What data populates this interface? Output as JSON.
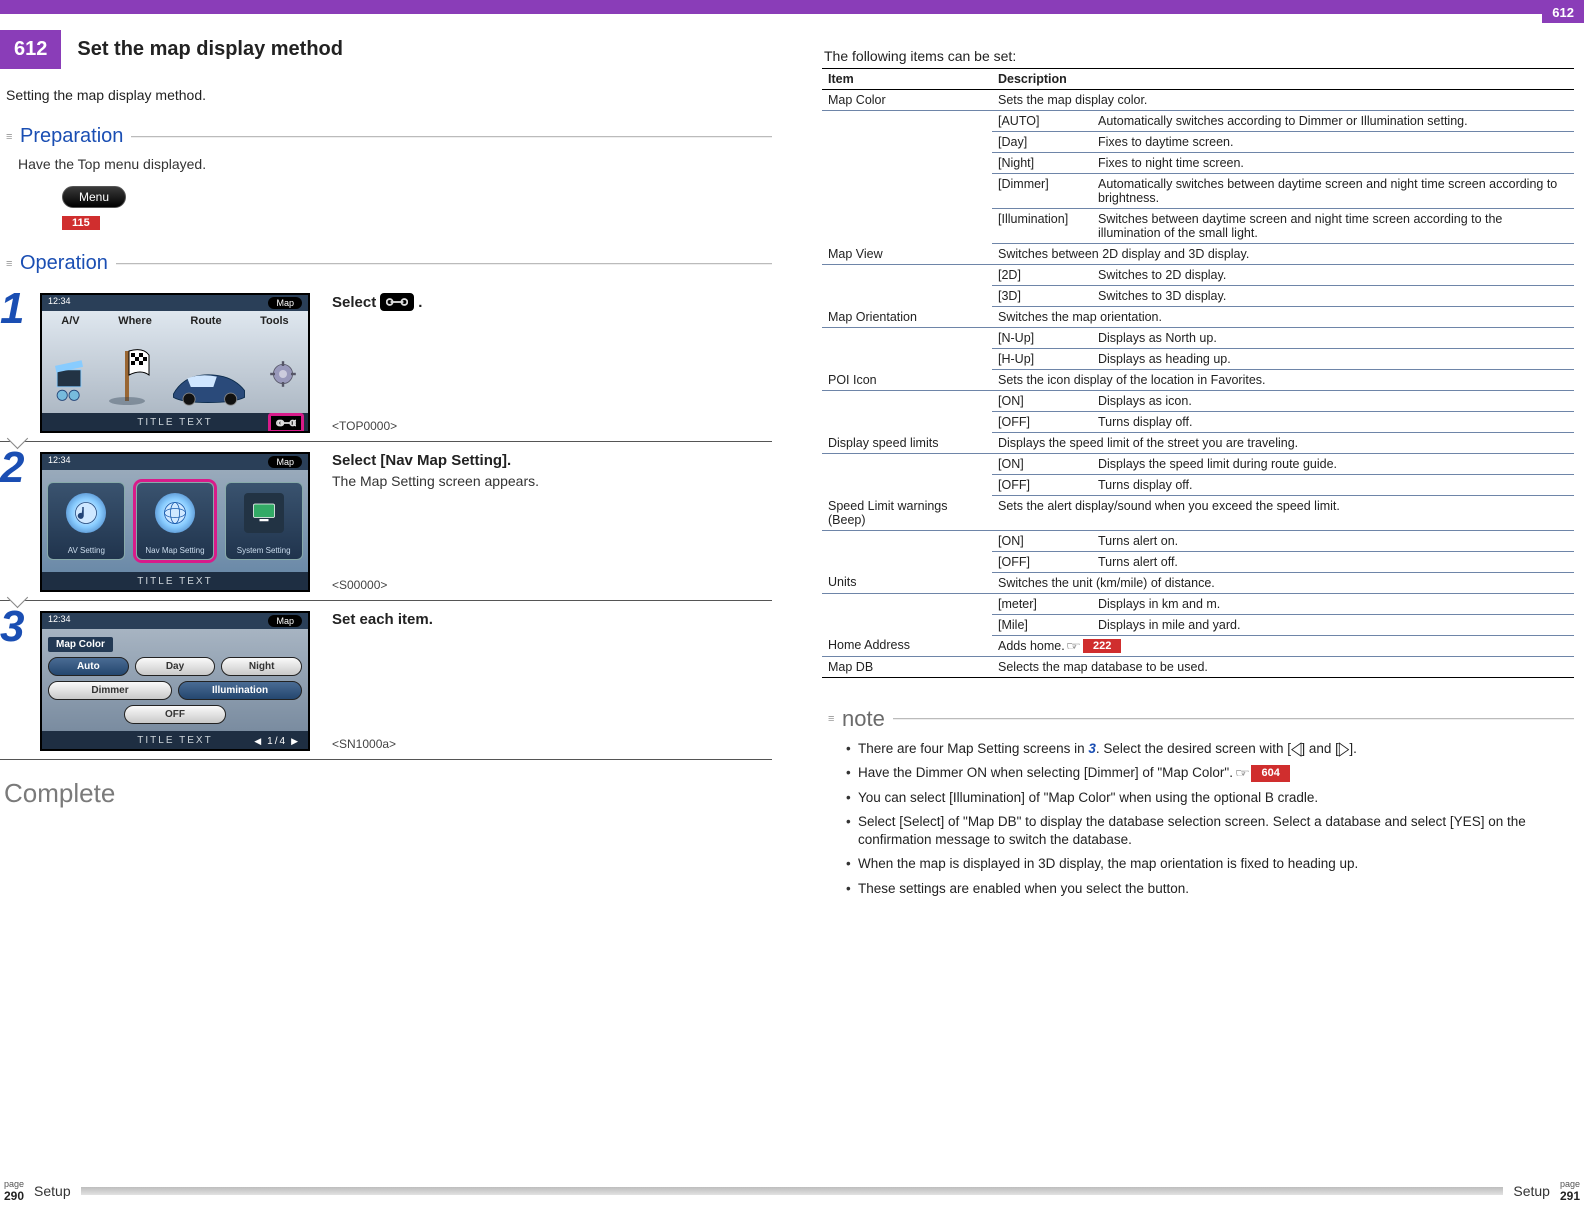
{
  "chapter": {
    "number": "612",
    "title": "Set the map display method",
    "subtitle": "Setting the map display method."
  },
  "top_badge": "612",
  "preparation": {
    "heading": "Preparation",
    "text": "Have the Top menu displayed.",
    "menu_label": "Menu",
    "ref": "115"
  },
  "operation": {
    "heading": "Operation",
    "steps": [
      {
        "num": "1",
        "title_pre": "Select ",
        "title_post": ".",
        "ref": "<TOP0000>",
        "shot": {
          "time": "12:34",
          "map_btn": "Map",
          "tabs": [
            "A/V",
            "Where",
            "Route",
            "Tools"
          ],
          "bottom": "TITLE TEXT"
        }
      },
      {
        "num": "2",
        "title": "Select [Nav Map Setting].",
        "desc": "The Map Setting screen appears.",
        "ref": "<S00000>",
        "shot": {
          "time": "12:34",
          "map_btn": "Map",
          "panels": [
            "AV Setting",
            "Nav Map Setting",
            "System Setting"
          ],
          "bottom": "TITLE TEXT"
        }
      },
      {
        "num": "3",
        "title": "Set each item.",
        "ref": "<SN1000a>",
        "shot": {
          "time": "12:34",
          "map_btn": "Map",
          "sect_title": "Map Color",
          "row1": [
            "Auto",
            "Day",
            "Night"
          ],
          "row2": [
            "Dimmer",
            "Illumination"
          ],
          "row3": "OFF",
          "pager": "1/4",
          "bottom": "TITLE TEXT"
        }
      }
    ],
    "complete": "Complete"
  },
  "right": {
    "tbl_intro": "The following items can be set:",
    "headers": [
      "Item",
      "Description"
    ],
    "rows": [
      {
        "item": "Map Color",
        "desc": "Sets the map display color.",
        "subs": [
          {
            "k": "[AUTO]",
            "v": "Automatically switches according to Dimmer or Illumination setting."
          },
          {
            "k": "[Day]",
            "v": "Fixes to daytime screen."
          },
          {
            "k": "[Night]",
            "v": "Fixes to night time screen."
          },
          {
            "k": "[Dimmer]",
            "v": "Automatically switches between daytime screen and night time screen according to brightness."
          },
          {
            "k": "[Illumination]",
            "v": "Switches between daytime screen and night time screen according to the illumination of the small light."
          }
        ]
      },
      {
        "item": "Map View",
        "desc": "Switches between 2D display and 3D display.",
        "subs": [
          {
            "k": "[2D]",
            "v": "Switches to 2D display."
          },
          {
            "k": "[3D]",
            "v": "Switches to 3D display."
          }
        ]
      },
      {
        "item": "Map Orientation",
        "desc": "Switches the map orientation.",
        "subs": [
          {
            "k": "[N-Up]",
            "v": "Displays as North up."
          },
          {
            "k": "[H-Up]",
            "v": "Displays as heading up."
          }
        ]
      },
      {
        "item": "POI Icon",
        "desc": "Sets the icon display of the location in Favorites.",
        "subs": [
          {
            "k": "[ON]",
            "v": "Displays as icon."
          },
          {
            "k": "[OFF]",
            "v": "Turns display off."
          }
        ]
      },
      {
        "item": "Display speed limits",
        "desc": "Displays the speed limit of the street you are traveling.",
        "subs": [
          {
            "k": "[ON]",
            "v": "Displays the speed limit during route guide."
          },
          {
            "k": "[OFF]",
            "v": "Turns display off."
          }
        ]
      },
      {
        "item": "Speed Limit warnings (Beep)",
        "desc": "Sets the alert display/sound when you exceed the speed limit.",
        "subs": [
          {
            "k": "[ON]",
            "v": "Turns alert on."
          },
          {
            "k": "[OFF]",
            "v": "Turns alert off."
          }
        ]
      },
      {
        "item": "Units",
        "desc": "Switches the unit (km/mile) of distance.",
        "subs": [
          {
            "k": "[meter]",
            "v": "Displays in km and m."
          },
          {
            "k": "[Mile]",
            "v": "Displays in mile and yard."
          }
        ]
      },
      {
        "item": "Home Address",
        "desc_pre": "Adds home. ",
        "ref": "222"
      },
      {
        "item": "Map DB",
        "desc": "Selects the map database to be used."
      }
    ]
  },
  "note": {
    "heading": "note",
    "items": [
      {
        "pre": "There are four Map Setting screens in ",
        "step": "3",
        "post": ". Select the desired screen with [",
        "post2": "] and [",
        "post3": "]."
      },
      {
        "pre": "Have the Dimmer ON when selecting [Dimmer] of \"Map Color\". ",
        "ref": "604"
      },
      {
        "text": "You can select [Illumination] of \"Map Color\" when using the optional B cradle."
      },
      {
        "text": "Select [Select] of \"Map DB\" to display the database selection screen. Select a database and select [YES] on the confirmation message to switch the database."
      },
      {
        "text": "When the map is displayed in 3D display, the map orientation is fixed to heading up."
      },
      {
        "text": "These settings are enabled when you select the button."
      }
    ]
  },
  "footer": {
    "left_page_label": "page",
    "left_page_num": "290",
    "section": "Setup",
    "right_page_label": "page",
    "right_page_num": "291"
  }
}
